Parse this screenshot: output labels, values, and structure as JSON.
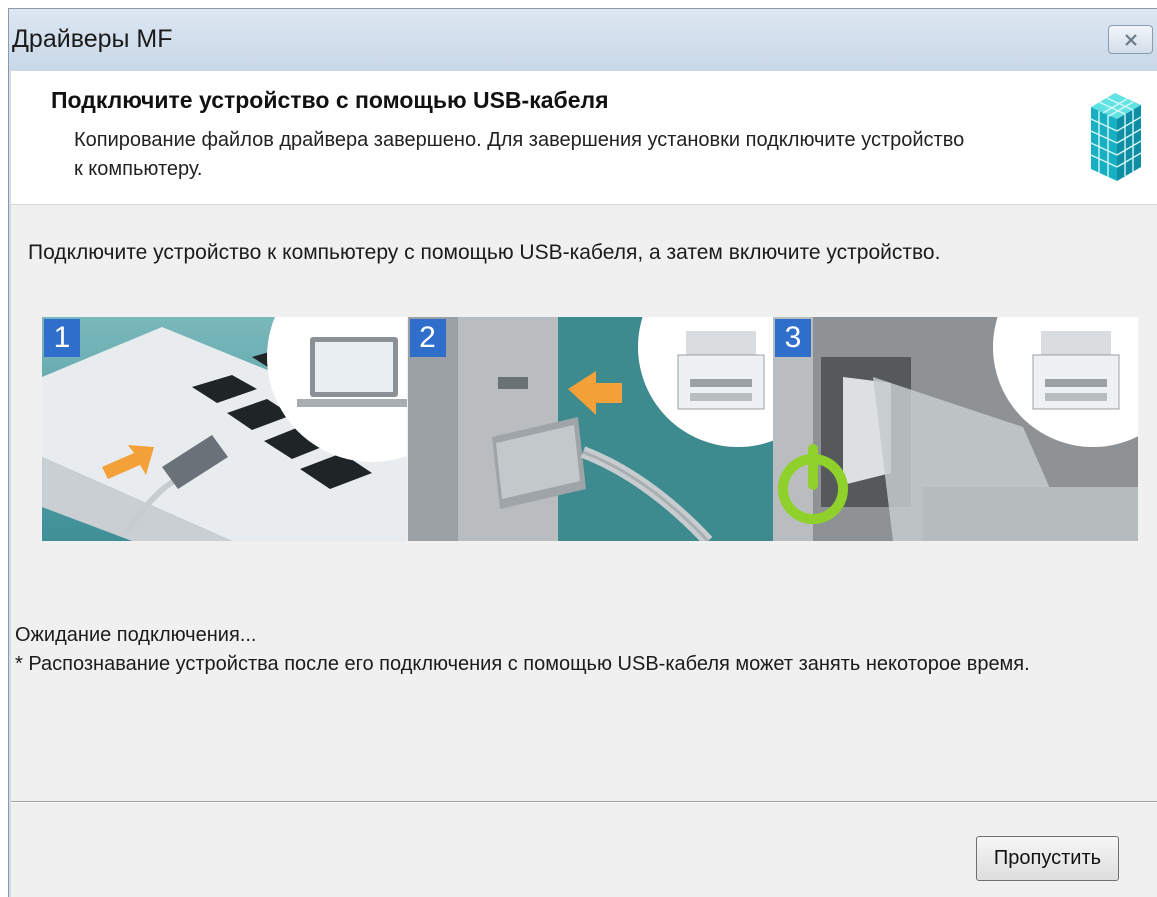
{
  "window": {
    "title": "Драйверы MF"
  },
  "header": {
    "title": "Подключите устройство с помощью USB-кабеля",
    "description": "Копирование файлов драйвера завершено. Для завершения установки подключите устройство к компьютеру."
  },
  "instruction": "Подключите устройство к компьютеру с помощью USB-кабеля, а затем включите устройство.",
  "steps": [
    {
      "number": "1",
      "icon": "laptop-usb-icon"
    },
    {
      "number": "2",
      "icon": "printer-usb-port-icon"
    },
    {
      "number": "3",
      "icon": "power-switch-icon"
    }
  ],
  "status": {
    "waiting": "Ожидание подключения...",
    "note": "* Распознавание устройства после его подключения с помощью USB-кабеля может занять некоторое время."
  },
  "buttons": {
    "skip": "Пропустить"
  },
  "colors": {
    "badge": "#2f6fcb",
    "arrow": "#f4a13a",
    "power": "#8fd12a"
  }
}
